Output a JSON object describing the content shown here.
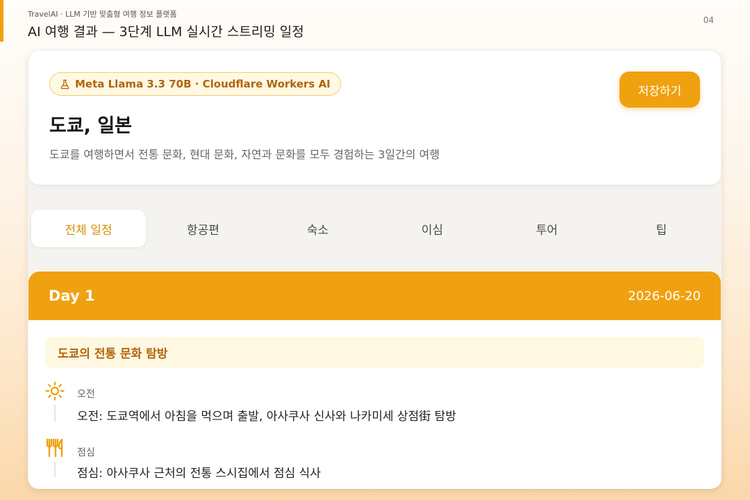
{
  "slide": {
    "platform": "TravelAI · LLM 기반 맞춤형 여행 정보 플랫폼",
    "title": "AI 여행 결과 — 3단계 LLM 실시간 스트리밍 일정",
    "page_number": "04"
  },
  "result": {
    "model_badge": "Meta Llama 3.3 70B · Cloudflare Workers AI",
    "save_label": "저장하기",
    "destination": "도쿄, 일본",
    "description": "도쿄를 여행하면서 전통 문화, 현대 문화, 자연과 문화를 모두 경험하는 3일간의 여행"
  },
  "tabs": [
    {
      "label": "전체 일정",
      "active": true
    },
    {
      "label": "항공편",
      "active": false
    },
    {
      "label": "숙소",
      "active": false
    },
    {
      "label": "이심",
      "active": false
    },
    {
      "label": "투어",
      "active": false
    },
    {
      "label": "팁",
      "active": false
    }
  ],
  "day": {
    "label": "Day 1",
    "date": "2026-06-20",
    "theme": "도쿄의 전통 문화 탐방",
    "items": [
      {
        "period": "오전",
        "detail": "오전: 도쿄역에서 아침을 먹으며 출발, 아사쿠사 신사와 나카미세 상점街 탐방",
        "icon": "sun-icon"
      },
      {
        "period": "점심",
        "detail": "점심: 아사쿠사 근처의 전통 스시집에서 점심 식사",
        "icon": "fork-knife-icon"
      }
    ]
  },
  "colors": {
    "accent": "#f0a10f",
    "accent_text": "#b0650a",
    "badge_bg": "#fff8e3"
  }
}
